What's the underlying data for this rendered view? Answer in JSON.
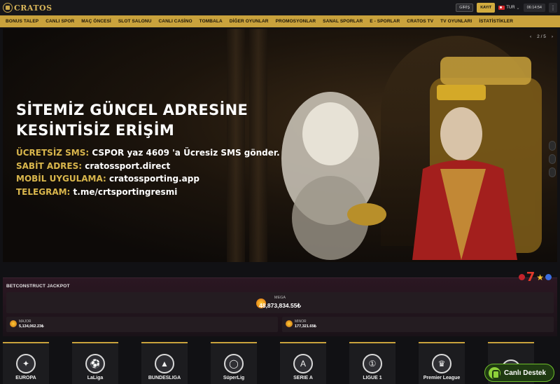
{
  "header": {
    "logo_text": "CRATOS",
    "login_label": "GİRİŞ",
    "register_label": "KAYIT",
    "language": "TUR",
    "clock": "06:14:54",
    "menu_icon": "kebab-icon"
  },
  "nav": {
    "items": [
      "BONUS TALEP",
      "CANLI SPOR",
      "MAÇ ÖNCESİ",
      "SLOT SALONU",
      "CANLI CASİNO",
      "TOMBALA",
      "DİĞER OYUNLAR",
      "PROMOSYONLAR",
      "SANAL SPORLAR",
      "E - SPORLAR",
      "CRATOS TV",
      "TV OYUNLARI",
      "İSTATİSTİKLER"
    ]
  },
  "hero": {
    "title_line1": "SİTEMİZ GÜNCEL ADRESİNE",
    "title_line2": "KESİNTİSİZ ERİŞİM",
    "lines": [
      {
        "key": "ÜCRETSİZ SMS:",
        "value": "CSPOR yaz 4609 'a Ücresiz SMS gönder."
      },
      {
        "key": "SABİT ADRES:",
        "value": "cratossport.direct"
      },
      {
        "key": "MOBİL UYGULAMA:",
        "value": "cratossporting.app"
      },
      {
        "key": "TELEGRAM:",
        "value": "t.me/crtsportingresmi"
      }
    ],
    "pager": "2 / 5",
    "prev_icon": "chevron-left-icon",
    "next_icon": "chevron-right-icon"
  },
  "jackpot": {
    "title": "BETCONSTRUCT JACKPOT",
    "mega_label": "MEGA",
    "mega_value": "48,873,834.55₺",
    "major_label": "MAJOR",
    "major_value": "5,134,062.23₺",
    "minor_label": "MINOR",
    "minor_value": "177,321.65₺"
  },
  "leagues": [
    {
      "name": "UEFA EUROPA LEAGUE",
      "label": "EUROPA",
      "icon": "europa-league-icon",
      "glyph": "✦"
    },
    {
      "name": "LaLiga",
      "label": "LaLiga",
      "icon": "laliga-icon",
      "glyph": "⚽"
    },
    {
      "name": "Bundesliga",
      "label": "BUNDESLIGA",
      "icon": "bundesliga-icon",
      "glyph": "▲"
    },
    {
      "name": "Süper Lig",
      "label": "SüperLig",
      "icon": "superlig-icon",
      "glyph": "◯"
    },
    {
      "name": "Serie A",
      "label": "SERIE A",
      "icon": "serie-a-icon",
      "glyph": "A"
    },
    {
      "name": "Ligue 1",
      "label": "LIGUE 1",
      "icon": "ligue1-icon",
      "glyph": "①"
    },
    {
      "name": "Premier League",
      "label": "Premier League",
      "icon": "premier-league-icon",
      "glyph": "♛"
    },
    {
      "name": "Champions League",
      "label": "",
      "icon": "champions-league-icon",
      "glyph": "✪"
    }
  ],
  "support": {
    "label": "Canlı Destek",
    "icon": "chat-support-icon"
  }
}
